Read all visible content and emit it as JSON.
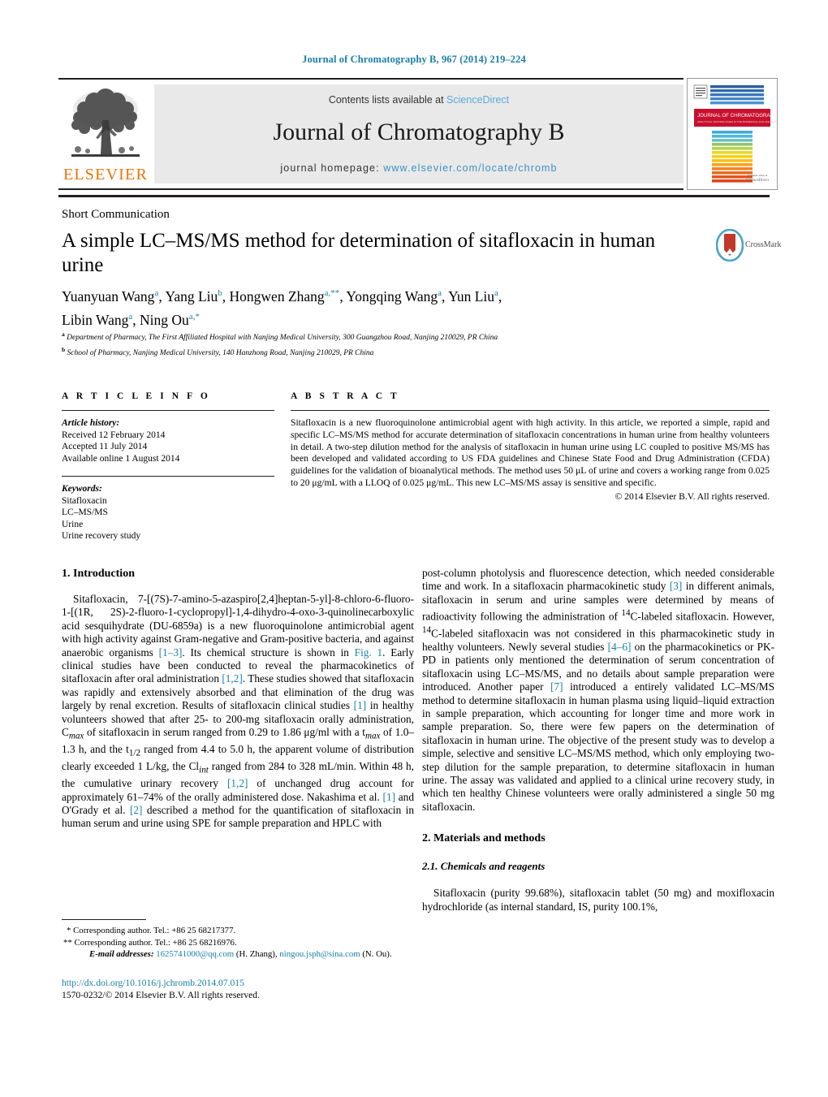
{
  "running_head": "Journal of Chromatography B, 967 (2014) 219–224",
  "masthead": {
    "contents_prefix": "Contents lists available at ",
    "contents_link": "ScienceDirect",
    "journal_title": "Journal of Chromatography B",
    "homepage_prefix": "journal homepage: ",
    "homepage_url": "www.elsevier.com/locate/chromb",
    "publisher_wordmark": "ELSEVIER",
    "publisher_color": "#ee7203",
    "link_color": "#3f8fc4",
    "cover": {
      "banner_title": "JOURNAL OF CHROMATOGRAPHY B",
      "banner_subtitle": "ANALYTICAL TECHNOLOGIES IN THE BIOMEDICAL AND LIFE SCIENCES",
      "banner_color": "#c8102e",
      "publisher_mark": "ScienceDirect"
    }
  },
  "article": {
    "type": "Short Communication",
    "title": "A simple LC–MS/MS method for determination of sitafloxacin in human urine",
    "badge": {
      "label": "CrossMark"
    },
    "authors": [
      {
        "name": "Yuanyuan Wang",
        "marks": "a"
      },
      {
        "name": "Yang Liu",
        "marks": "b"
      },
      {
        "name": "Hongwen Zhang",
        "marks": "a,**"
      },
      {
        "name": "Yongqing Wang",
        "marks": "a"
      },
      {
        "name": "Yun Liu",
        "marks": "a"
      },
      {
        "name": "Libin Wang",
        "marks": "a"
      },
      {
        "name": "Ning Ou",
        "marks": "a,*"
      }
    ],
    "affiliations": [
      {
        "mark": "a",
        "text": "Department of Pharmacy, The First Affiliated Hospital with Nanjing Medical University, 300 Guangzhou Road, Nanjing 210029, PR China"
      },
      {
        "mark": "b",
        "text": "School of Pharmacy, Nanjing Medical University, 140 Hanzhong Road, Nanjing 210029, PR China"
      }
    ]
  },
  "article_info": {
    "heading": "A R T I C L E   I N F O",
    "history_label": "Article history:",
    "history": [
      "Received 12 February 2014",
      "Accepted 11 July 2014",
      "Available online 1 August 2014"
    ],
    "keywords_label": "Keywords:",
    "keywords": [
      "Sitafloxacin",
      "LC–MS/MS",
      "Urine",
      "Urine recovery study"
    ]
  },
  "abstract": {
    "heading": "A B S T R A C T",
    "text": "Sitafloxacin is a new fluoroquinolone antimicrobial agent with high activity. In this article, we reported a simple, rapid and specific LC–MS/MS method for accurate determination of sitafloxacin concentrations in human urine from healthy volunteers in detail. A two-step dilution method for the analysis of sitafloxacin in human urine using LC coupled to positive MS/MS has been developed and validated according to US FDA guidelines and Chinese State Food and Drug Administration (CFDA) guidelines for the validation of bioanalytical methods. The method uses 50 μL of urine and covers a working range from 0.025 to 20 μg/mL with a LLOQ of 0.025 μg/mL. This new LC–MS/MS assay is sensitive and specific.",
    "copyright": "© 2014 Elsevier B.V. All rights reserved."
  },
  "body": {
    "section1_heading": "1.  Introduction",
    "intro_p1_a": "Sitafloxacin, 7-[(7S)-7-amino-5-azaspiro[2,4]heptan-5-yl]-8-chloro-6-fluoro-1-[(1R,  2S)-2-fluoro-1-cyclopropyl]-1,4-dihydro-4-oxo-3-quinolinecarboxylic acid sesquihydrate (DU-6859a) is a new fluoroquinolone antimicrobial agent with high activity against Gram-negative and Gram-positive bacteria, and against anaerobic organisms ",
    "ref_1_3": "[1–3]",
    "intro_p1_b": ". Its chemical structure is shown in ",
    "ref_fig1": "Fig. 1",
    "intro_p1_c": ". Early clinical studies have been conducted to reveal the pharmacokinetics of sitafloxacin after oral administration ",
    "ref_1_2": "[1,2]",
    "intro_p1_d": ". These studies showed that sitafloxacin was rapidly and extensively absorbed and that elimination of the drug was largely by renal excretion. Results of sitafloxacin clinical studies ",
    "ref_1": "[1]",
    "intro_p1_e": " in healthy volunteers showed that after 25- to 200-mg sitafloxacin orally administration, C",
    "sub_max1": "max",
    "intro_p1_f": " of sitafloxacin in serum ranged from 0.29 to 1.86 μg/ml with a t",
    "sub_max2": "max",
    "intro_p1_g": " of 1.0–1.3 h, and the t",
    "sub_half": "1/2",
    "intro_p1_h": " ranged from 4.4 to 5.0 h, the apparent volume of distribution clearly exceeded 1 L/kg, the Cl",
    "sub_int": "int",
    "intro_p1_i": " ranged from 284 to 328 mL/min. Within 48 h, the cumulative urinary recovery ",
    "ref_1_2b": "[1,2]",
    "intro_p1_j": " of unchanged drug account for approximately 61–74% of the orally administered dose. Nakashima et al. ",
    "ref_1b": "[1]",
    "intro_p1_k": " and O'Grady et al. ",
    "ref_2": "[2]",
    "intro_p1_l": " described a method for the quantification of sitafloxacin in human serum and urine using SPE for sample preparation and HPLC with",
    "right_p1_a": "post-column photolysis and fluorescence detection, which needed considerable time and work. In a sitafloxacin pharmacokinetic study ",
    "ref_3": "[3]",
    "right_p1_b": " in different animals, sitafloxacin in serum and urine samples were determined by means of radioactivity following the administration of ",
    "sup_14a": "14",
    "right_p1_c": "C-labeled sitafloxacin. However, ",
    "sup_14b": "14",
    "right_p1_d": "C-labeled sitafloxacin was not considered in this pharmacokinetic study in healthy volunteers. Newly several studies ",
    "ref_4_6": "[4–6]",
    "right_p1_e": " on the pharmacokinetics or PK-PD in patients only mentioned the determination of serum concentration of sitafloxacin using LC–MS/MS, and no details about sample preparation were introduced. Another paper ",
    "ref_7": "[7]",
    "right_p1_f": " introduced a entirely validated LC–MS/MS method to determine sitafloxacin in human plasma using liquid–liquid extraction in sample preparation, which accounting for longer time and more work in sample preparation. So, there were few papers on the determination of sitafloxacin in human urine. The objective of the present study was to develop a simple, selective and sensitive LC–MS/MS method, which only employing two-step dilution for the sample preparation, to determine sitafloxacin in human urine. The assay was validated and applied to a clinical urine recovery study, in which ten healthy Chinese volunteers were orally administered a single 50 mg sitafloxacin.",
    "section2_heading": "2.  Materials and methods",
    "subsection21_heading": "2.1.  Chemicals and reagents",
    "chem_p1": "Sitafloxacin (purity 99.68%), sitafloxacin tablet (50 mg) and moxifloxacin hydrochloride (as internal standard, IS, purity 100.1%,"
  },
  "footnotes": {
    "corr1": "Corresponding author. Tel.: +86 25 68217377.",
    "corr1_mark": "*",
    "corr2": "Corresponding author. Tel.: +86 25 68216976.",
    "corr2_mark": "**",
    "email_label": "E-mail addresses:",
    "email1": "1625741000@qq.com",
    "email1_name": "(H. Zhang)",
    "email2": "ningou.jsph@sina.com",
    "email2_name": "(N. Ou).",
    "doi": "http://dx.doi.org/10.1016/j.jchromb.2014.07.015",
    "issn_line": "1570-0232/© 2014 Elsevier B.V. All rights reserved."
  },
  "colors": {
    "accent_blue": "#1a7fa8",
    "link_blue": "#3f8fc4",
    "elsevier_orange": "#ee7203",
    "band_grey": "#e9e9e9",
    "rule_black": "#231f20"
  }
}
